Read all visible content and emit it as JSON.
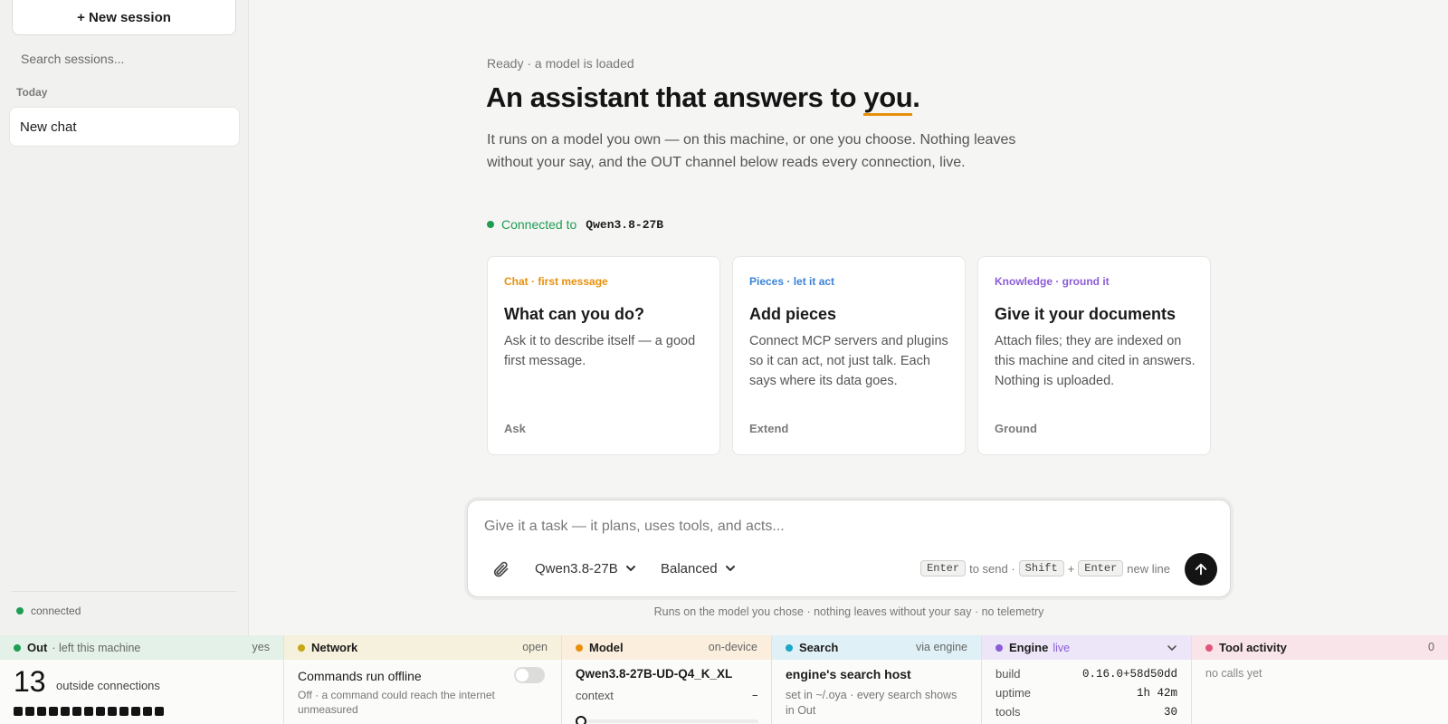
{
  "sidebar": {
    "new_session": "+ New session",
    "search_placeholder": "Search sessions...",
    "group_today": "Today",
    "items": [
      {
        "label": "New chat"
      }
    ],
    "status": "connected"
  },
  "hero": {
    "ready": "Ready · a model is loaded",
    "headline_pre": "An assistant that answers to ",
    "headline_you": "you",
    "headline_post": ".",
    "lede": "It runs on a model you own — on this machine, or one you choose. Nothing leaves without your say, and the OUT channel below reads every connection, live.",
    "connected_label": "Connected to",
    "connected_model": "Qwen3.8-27B"
  },
  "cards": [
    {
      "kicker": "Chat · first message",
      "title": "What can you do?",
      "body": "Ask it to describe itself — a good first message.",
      "foot": "Ask",
      "color": "#e8900c"
    },
    {
      "kicker": "Pieces · let it act",
      "title": "Add pieces",
      "body": "Connect MCP servers and plugins so it can act, not just talk. Each says where its data goes.",
      "foot": "Extend",
      "color": "#3b82d6"
    },
    {
      "kicker": "Knowledge · ground it",
      "title": "Give it your documents",
      "body": "Attach files; they are indexed on this machine and cited in answers. Nothing is uploaded.",
      "foot": "Ground",
      "color": "#8b5cd6"
    }
  ],
  "composer": {
    "placeholder": "Give it a task — it plans, uses tools, and acts...",
    "model": "Qwen3.8-27B",
    "mode": "Balanced",
    "key_enter": "Enter",
    "to_send": "to send ·",
    "key_shift": "Shift",
    "plus": "+",
    "new_line": "new line",
    "footnote": "Runs on the model you chose · nothing leaves without your say · no telemetry"
  },
  "panels": {
    "out": {
      "name": "Out",
      "sub": "· left this machine",
      "right": "yes",
      "count": "13",
      "count_label": "outside connections",
      "squares": 13,
      "color": "#1f9d55",
      "bg": "#e3f1e8"
    },
    "network": {
      "name": "Network",
      "right": "open",
      "row_title": "Commands run offline",
      "row_desc": "Off · a command could reach the internet unmeasured",
      "color": "#c7a617",
      "bg": "#f6f1dc"
    },
    "model": {
      "name": "Model",
      "right": "on-device",
      "model_id": "Qwen3.8-27B-UD-Q4_K_XL",
      "context_label": "context",
      "context_value": "–",
      "color": "#e8900c",
      "bg": "#fbeedd"
    },
    "search": {
      "name": "Search",
      "right": "via engine",
      "title": "engine's search host",
      "desc": "set in ~/.oya · every search shows in Out",
      "color": "#1ea5c9",
      "bg": "#dff0f6"
    },
    "engine": {
      "name": "Engine",
      "live": "live",
      "rows": [
        {
          "k": "build",
          "v": "0.16.0+58d50dd"
        },
        {
          "k": "uptime",
          "v": "1h 42m"
        },
        {
          "k": "tools",
          "v": "30"
        }
      ],
      "color": "#8b5cd6",
      "bg": "#ece6f8"
    },
    "tools": {
      "name": "Tool activity",
      "right": "0",
      "empty": "no calls yet",
      "color": "#e0567a",
      "bg": "#f9e4ea"
    }
  }
}
